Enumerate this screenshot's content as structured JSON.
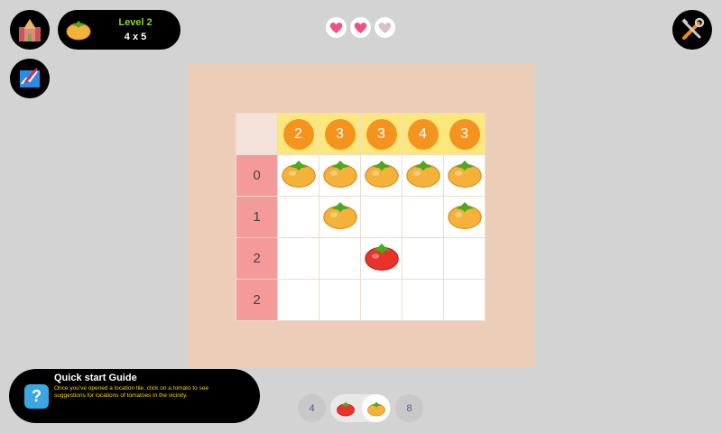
{
  "header": {
    "level_title": "Level 2",
    "level_size": "4 x 5",
    "hearts": [
      "full",
      "full",
      "empty"
    ]
  },
  "grid": {
    "col_clues": [
      "2",
      "3",
      "3",
      "4",
      "3"
    ],
    "row_clues": [
      "0",
      "1",
      "2",
      "2"
    ],
    "cells": [
      [
        "yellow",
        "yellow",
        "yellow",
        "yellow",
        "yellow"
      ],
      [
        "empty",
        "yellow",
        "empty",
        "empty",
        "yellow"
      ],
      [
        "empty",
        "empty",
        "red",
        "empty",
        "empty"
      ],
      [
        "empty",
        "empty",
        "empty",
        "empty",
        "empty"
      ]
    ]
  },
  "guide": {
    "title": "Quick start Guide",
    "body": "Once you've opened a location tile, click on a tomato to see suggestions for locations of tomatoes in the vicinity.",
    "icon": "?"
  },
  "bottom": {
    "left_count": "4",
    "right_count": "8",
    "selected": "yellow"
  },
  "colors": {
    "background": "#d3d3d3",
    "board": "#ebcdb8",
    "column_header": "#fbe77c",
    "row_header": "#f49a9a",
    "badge": "#f5931f",
    "level_text": "#8fd12a",
    "guide_text": "#f5d300"
  },
  "icons": {
    "home": "castle-icon",
    "stats": "chart-icon",
    "settings": "tools-icon",
    "level": "yellow-tomato-icon",
    "heart": "heart-icon"
  }
}
